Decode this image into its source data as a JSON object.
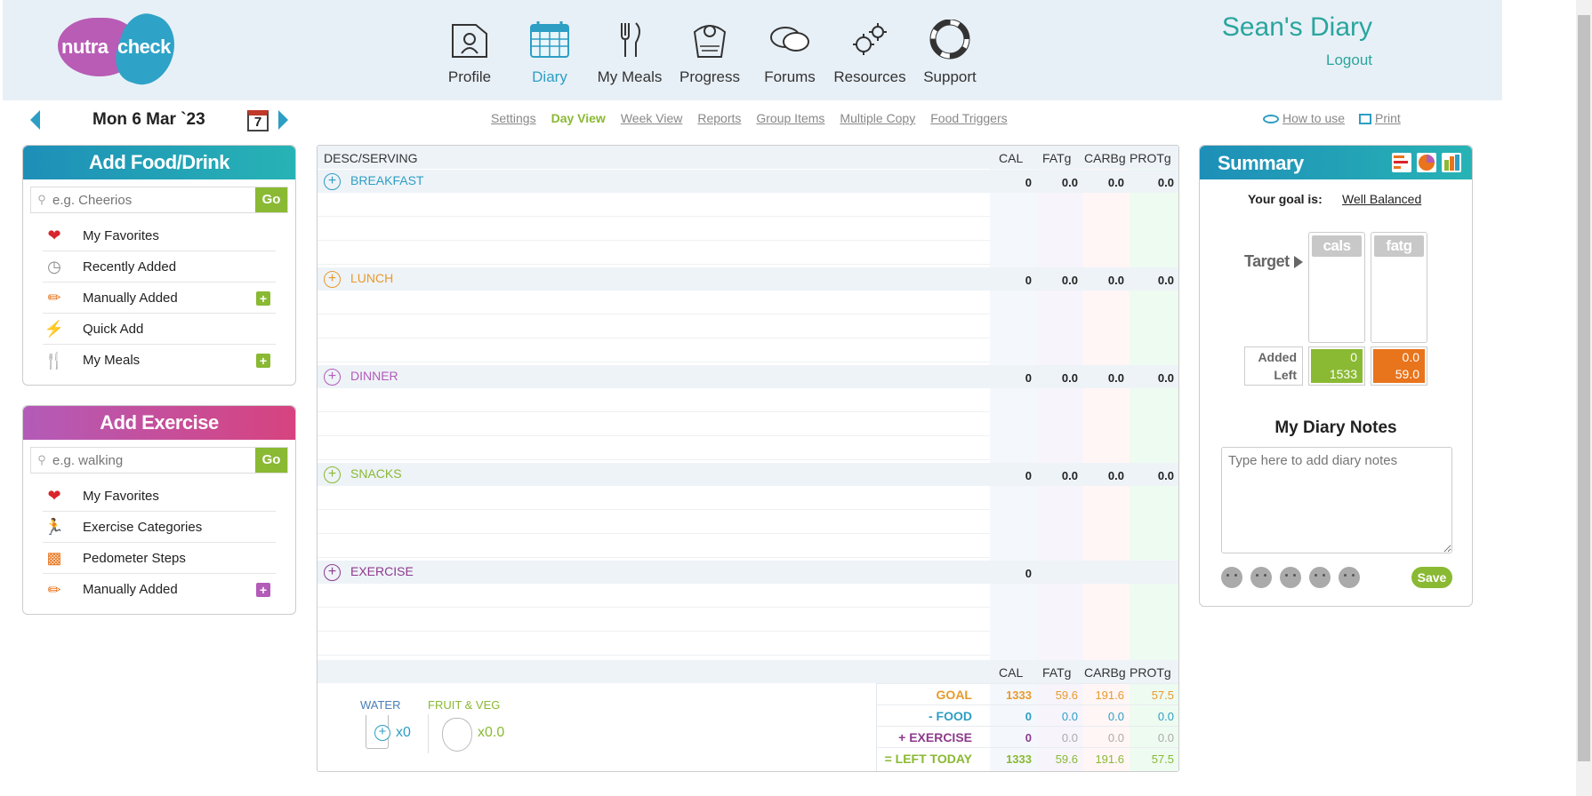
{
  "brand": {
    "word1": "nutra",
    "word2": "check"
  },
  "nav": [
    {
      "label": "Profile",
      "icon": "profile-icon"
    },
    {
      "label": "Diary",
      "icon": "calendar-icon",
      "active": true
    },
    {
      "label": "My Meals",
      "icon": "cutlery-icon"
    },
    {
      "label": "Progress",
      "icon": "scale-icon"
    },
    {
      "label": "Forums",
      "icon": "chat-bubbles-icon"
    },
    {
      "label": "Resources",
      "icon": "gears-icon"
    },
    {
      "label": "Support",
      "icon": "lifebuoy-icon"
    }
  ],
  "user": {
    "diary_title": "Sean's Diary",
    "logout": "Logout"
  },
  "date": {
    "label": "Mon 6 Mar `23",
    "calendar_day": "7"
  },
  "subnav": [
    "Settings",
    "Day View",
    "Week View",
    "Reports",
    "Group Items",
    "Multiple Copy",
    "Food Triggers"
  ],
  "subnav_active": "Day View",
  "help": {
    "how_to_use": "How to use",
    "print": "Print"
  },
  "add_food": {
    "title": "Add Food/Drink",
    "placeholder": "e.g. Cheerios",
    "go": "Go",
    "items": [
      {
        "label": "My Favorites",
        "icon": "heart-icon"
      },
      {
        "label": "Recently Added",
        "icon": "clock-icon"
      },
      {
        "label": "Manually Added",
        "icon": "pencil-icon"
      },
      {
        "label": "Quick Add",
        "icon": "lightning-icon"
      },
      {
        "label": "My Meals",
        "icon": "cutlery-icon"
      }
    ]
  },
  "add_exercise": {
    "title": "Add Exercise",
    "placeholder": "e.g. walking",
    "go": "Go",
    "items": [
      {
        "label": "My Favorites",
        "icon": "heart-icon"
      },
      {
        "label": "Exercise Categories",
        "icon": "runner-icon"
      },
      {
        "label": "Pedometer Steps",
        "icon": "pedometer-icon"
      },
      {
        "label": "Manually Added",
        "icon": "pencil-icon"
      }
    ]
  },
  "table": {
    "headers": {
      "desc": "DESC/SERVING",
      "cal": "CAL",
      "fat": "FATg",
      "carb": "CARBg",
      "prot": "PROTg"
    },
    "meals": [
      {
        "name": "BREAKFAST",
        "color": "#2d9ec4",
        "cal": "0",
        "fat": "0.0",
        "carb": "0.0",
        "prot": "0.0"
      },
      {
        "name": "LUNCH",
        "color": "#e89a2c",
        "cal": "0",
        "fat": "0.0",
        "carb": "0.0",
        "prot": "0.0"
      },
      {
        "name": "DINNER",
        "color": "#b35bb8",
        "cal": "0",
        "fat": "0.0",
        "carb": "0.0",
        "prot": "0.0"
      },
      {
        "name": "SNACKS",
        "color": "#8ab933",
        "cal": "0",
        "fat": "0.0",
        "carb": "0.0",
        "prot": "0.0"
      },
      {
        "name": "EXERCISE",
        "color": "#8e3a8c",
        "cal": "0",
        "fat": "",
        "carb": "",
        "prot": ""
      }
    ],
    "totals": [
      {
        "label": "GOAL",
        "color": "#e89a2c",
        "cal": "1333",
        "fat": "59.6",
        "carb": "191.6",
        "prot": "57.5"
      },
      {
        "label": "- FOOD",
        "color": "#2d9ec4",
        "cal": "0",
        "fat": "0.0",
        "carb": "0.0",
        "prot": "0.0"
      },
      {
        "label": "+ EXERCISE",
        "color": "#8e3a8c",
        "cal": "0",
        "fat": "0.0",
        "carb": "0.0",
        "prot": "0.0"
      },
      {
        "label": "= LEFT TODAY",
        "color": "#8ab933",
        "cal": "1333",
        "fat": "59.6",
        "carb": "191.6",
        "prot": "57.5"
      }
    ],
    "water": {
      "label": "WATER",
      "count": "x0"
    },
    "fruit_veg": {
      "label": "FRUIT & VEG",
      "count": "x0.0"
    }
  },
  "summary": {
    "title": "Summary",
    "goal_label": "Your goal is:",
    "goal_value": "Well Balanced",
    "target_label": "Target",
    "bars": [
      {
        "name": "cals",
        "added": "0",
        "left": "1533"
      },
      {
        "name": "fatg",
        "added": "0.0",
        "left": "59.0"
      }
    ],
    "added_label": "Added",
    "left_label": "Left",
    "notes_title": "My Diary Notes",
    "notes_placeholder": "Type here to add diary notes",
    "save": "Save"
  }
}
